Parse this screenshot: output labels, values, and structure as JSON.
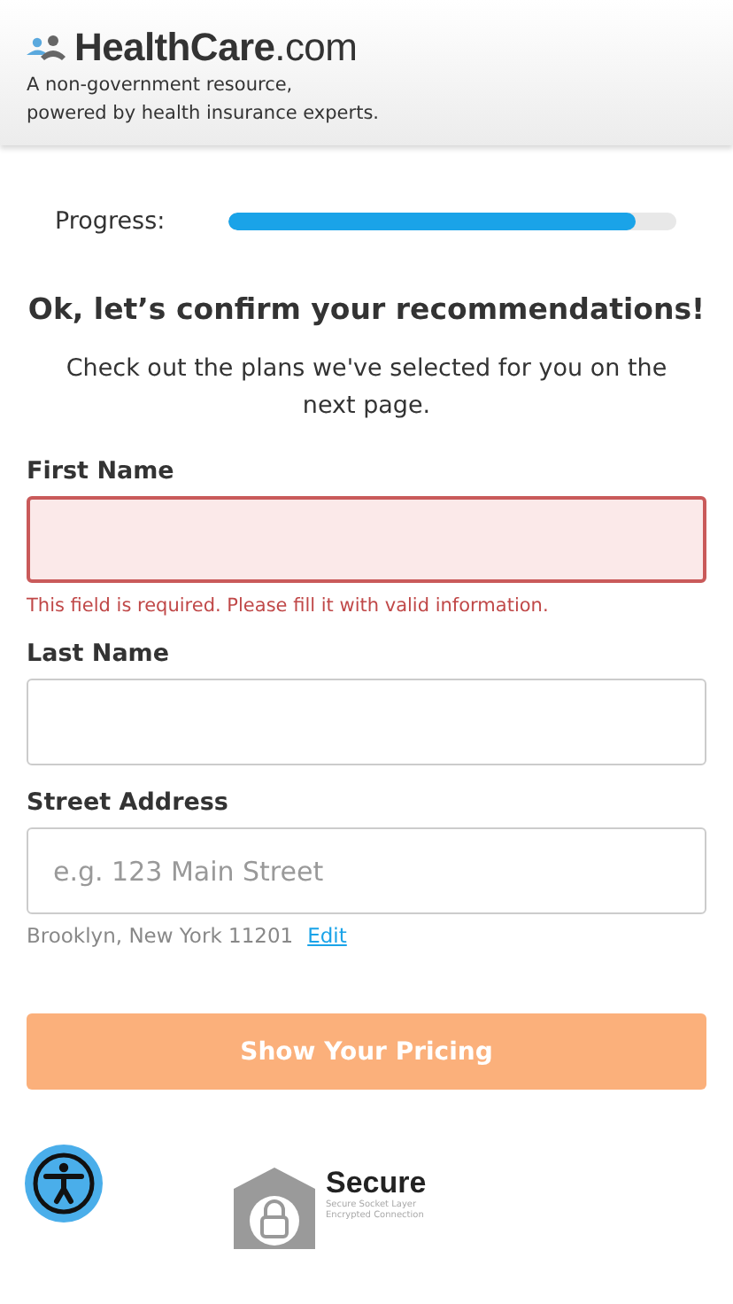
{
  "header": {
    "logo": "**HealthCare**.com",
    "tagline_lines": [
      "A non-government resource,",
      "powered by health insurance experts."
    ]
  },
  "progress": {
    "label": "Progress:",
    "level": 0.91
  },
  "heading": "Ok, let’s confirm your recommendations!",
  "subheading": "Check out the plans we've selected for you on the next page.",
  "fields": [
    {
      "label": "First Name",
      "error": true,
      "error_message": "This field is required. Please fill it with valid information."
    },
    {
      "label": "Last Name",
      "error": false
    },
    {
      "label": "Street Address",
      "error": false,
      "placeholder": "e.g. 123 Main Street",
      "location": "Brooklyn, New York 11201",
      "location_link": "Edit"
    }
  ],
  "submit": {
    "label": "Show Your Pricing",
    "disabled": true
  },
  "secure_badge": {
    "title": "Secure",
    "subtitle_lines": [
      "Secure Socket Layer",
      "Encrypted Connection"
    ]
  }
}
